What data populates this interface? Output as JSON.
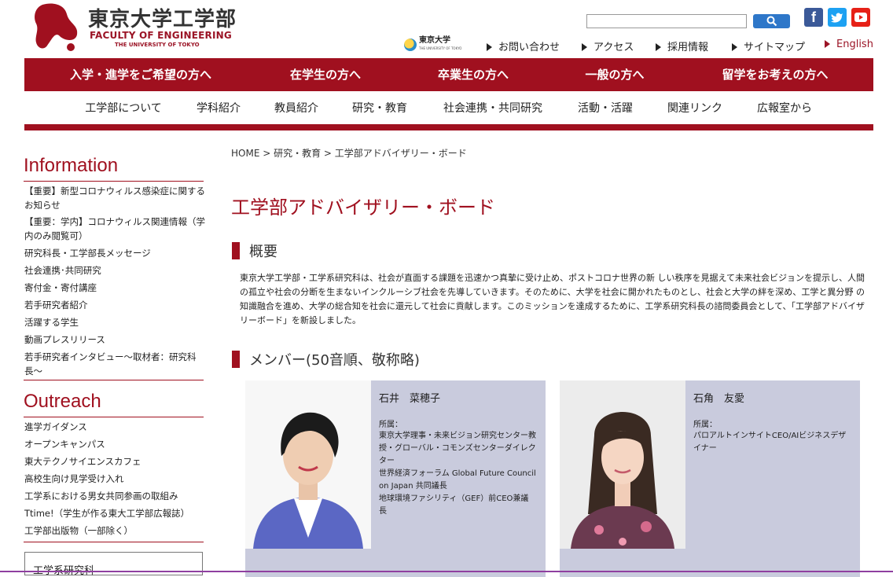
{
  "header": {
    "logo_jp": "東京大学工学部",
    "logo_en": "FACULTY OF ENGINEERING",
    "logo_en_sub": "THE UNIVERSITY OF TOKYO",
    "ut_logo_text": "東京大学",
    "ut_logo_sub": "THE UNIVERSITY OF TOKYO",
    "search_placeholder": "",
    "links": {
      "contact": "お問い合わせ",
      "access": "アクセス",
      "recruit": "採用情報",
      "sitemap": "サイトマップ",
      "english": "English"
    }
  },
  "rednav": [
    "入学・進学をご希望の方へ",
    "在学生の方へ",
    "卒業生の方へ",
    "一般の方へ",
    "留学をお考えの方へ"
  ],
  "subnav": [
    "工学部について",
    "学科紹介",
    "教員紹介",
    "研究・教育",
    "社会連携・共同研究",
    "活動・活躍",
    "関連リンク",
    "広報室から"
  ],
  "sidebar": {
    "info_head": "Information",
    "info_items": [
      "【重要】新型コロナウィルス感染症に関するお知らせ",
      "【重要：学内】コロナウィルス関連情報（学内のみ閲覧可）",
      "研究科長・工学部長メッセージ",
      "社会連携･共同研究",
      "寄付金・寄付講座",
      "若手研究者紹介",
      "活躍する学生",
      "動画プレスリリース",
      "若手研究者インタビュー〜取材者：研究科長〜"
    ],
    "outreach_head": "Outreach",
    "outreach_items": [
      "進学ガイダンス",
      "オープンキャンパス",
      "東大テクノサイエンスカフェ",
      "高校生向け見学受け入れ",
      "工学系における男女共同参画の取組み",
      "Ttime!（学生が作る東大工学部広報誌）",
      "工学部出版物（一部除く）"
    ],
    "box_label": "工学系研究科"
  },
  "main": {
    "breadcrumb": "HOME > 研究・教育 > 工学部アドバイザリー・ボード",
    "title": "工学部アドバイザリー・ボード",
    "overview_head": "概要",
    "overview_text": "東京大学工学部・工学系研究科は、社会が直面する課題を迅速かつ真摯に受け止め、ポストコロナ世界の新 しい秩序を見据えて未来社会ビジョンを提示し、人間の孤立や社会の分断を生まないインクルーシブ社会を先導していきます。そのために、大学を社会に開かれたものとし、社会と大学の絆を深め、工学と異分野 の知識融合を進め、大学の総合知を社会に還元して社会に貢献します。このミッションを達成するために、工学系研究科長の諮問委員会として、「工学部アドバイザリーボード」を新設しました。",
    "members_head": "メンバー(50音順、敬称略)",
    "members": [
      {
        "name": "石井　菜穂子",
        "aff_label": "所属：",
        "aff": "東京大学理事・未来ビジョン研究センター教授・グローバル・コモンズセンターダイレクター\n世界経済フォーラム Global Future Council on Japan 共同議長\n地球環境ファシリティ（GEF）前CEO兼議長"
      },
      {
        "name": "石角　友愛",
        "aff_label": "所属：",
        "aff": "パロアルトインサイトCEO/AIビジネスデザイナー"
      }
    ]
  },
  "colors": {
    "brand_red": "#a0101f",
    "card_bg": "#c9cbdd"
  }
}
